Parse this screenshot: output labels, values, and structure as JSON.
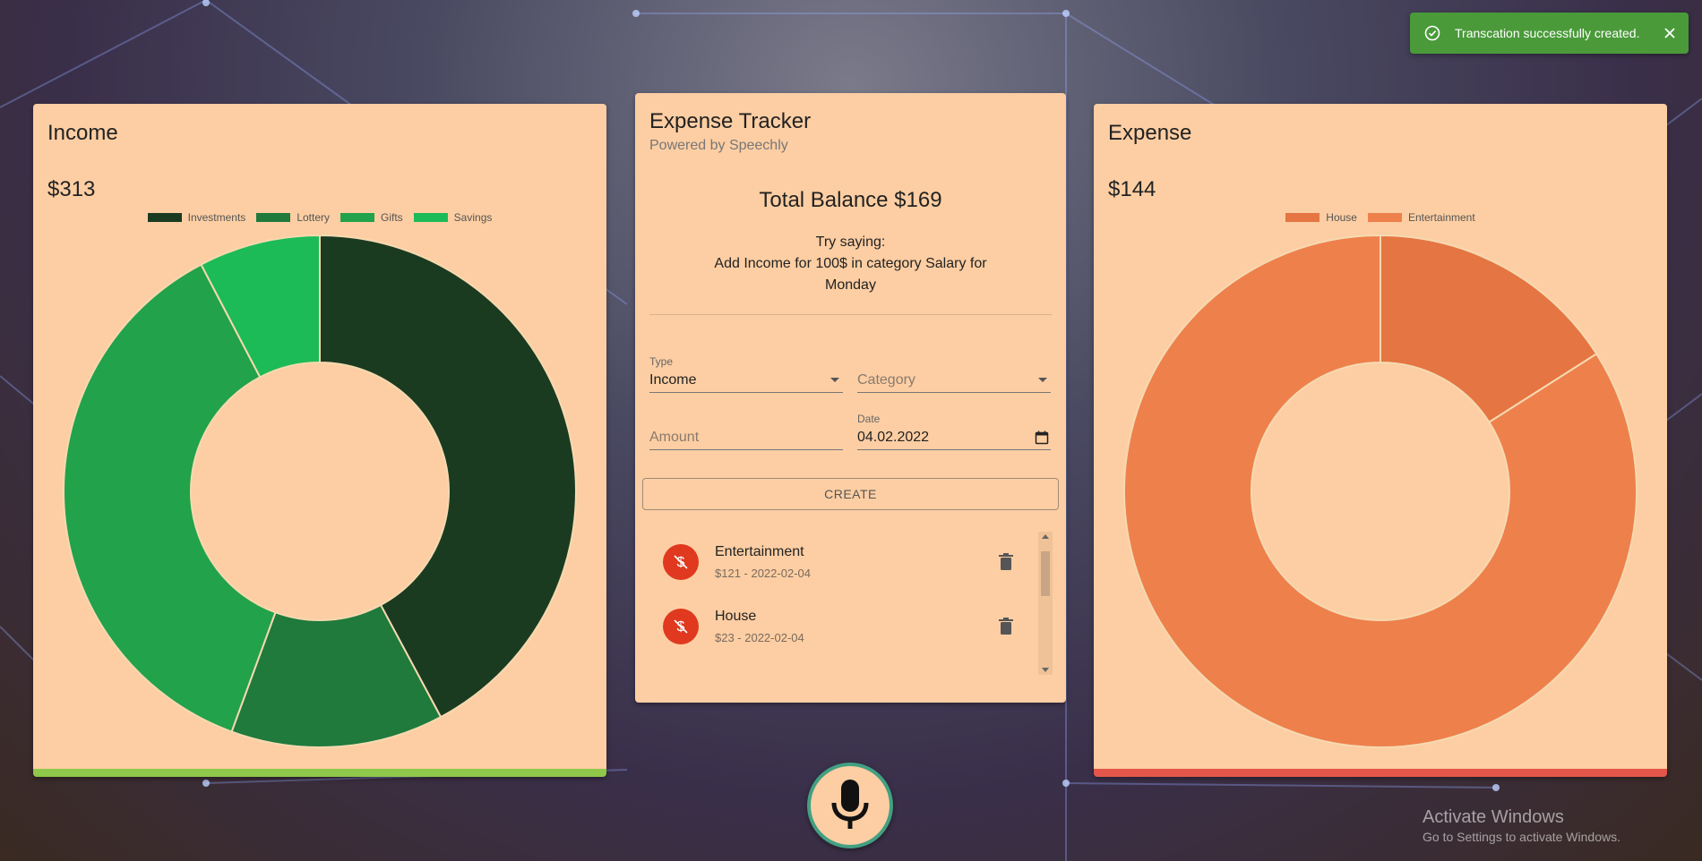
{
  "notification": {
    "message": "Transcation successfully created.",
    "icon": "check-circle-icon"
  },
  "income": {
    "title": "Income",
    "amount": "$313",
    "legend": [
      "Investments",
      "Lottery",
      "Gifts",
      "Savings"
    ],
    "chart_data": {
      "type": "pie",
      "donut": true,
      "labels": [
        "Investments",
        "Lottery",
        "Gifts",
        "Savings"
      ],
      "values": [
        132,
        42,
        115,
        24
      ],
      "colors": [
        "#1b3b21",
        "#1f7a3c",
        "#22a24a",
        "#1dbb58"
      ],
      "start_at": "top"
    }
  },
  "expense": {
    "title": "Expense",
    "amount": "$144",
    "legend": [
      "House",
      "Entertainment"
    ],
    "chart_data": {
      "type": "pie",
      "donut": true,
      "labels": [
        "House",
        "Entertainment"
      ],
      "values": [
        23,
        121
      ],
      "colors": [
        "#e57542",
        "#ee804c"
      ],
      "start_at": "top"
    }
  },
  "tracker": {
    "title": "Expense Tracker",
    "subtitle": "Powered by Speechly",
    "balance": "Total Balance $169",
    "hint_line1": "Try saying:",
    "hint_line2": "Add Income for 100$ in category Salary for Monday",
    "type_label": "Type",
    "type_value": "Income",
    "category_placeholder": "Category",
    "amount_placeholder": "Amount",
    "date_label": "Date",
    "date_value": "04.02.2022",
    "create_label": "CREATE",
    "transactions": [
      {
        "category": "Entertainment",
        "detail": "$121 - 2022-02-04"
      },
      {
        "category": "House",
        "detail": "$23 - 2022-02-04"
      }
    ]
  },
  "watermark": {
    "title": "Activate Windows",
    "subtitle": "Go to Settings to activate Windows."
  },
  "colors": {
    "card": "#fdcea3",
    "income_bar": "#8fc84a",
    "expense_bar": "#e5564a",
    "toast": "#4a9a3a",
    "avatar": "#e0391f",
    "mic_border": "#43a082"
  }
}
